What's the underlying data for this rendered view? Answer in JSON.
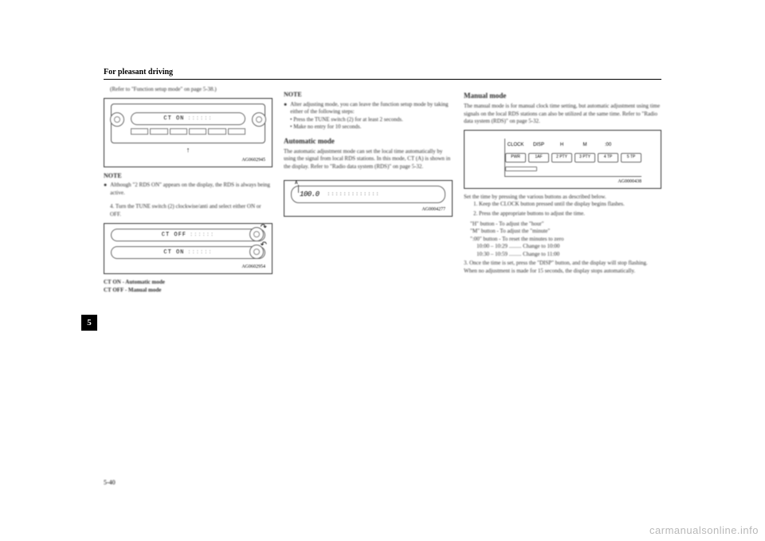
{
  "header": {
    "section_title": "For pleasant driving"
  },
  "tab": {
    "number": "5"
  },
  "footer": {
    "page_num": "5-40",
    "watermark": "carmanualsonline.info"
  },
  "col1": {
    "refer_text": "(Refer to \"Function setup mode\" on page 5-38.)",
    "fig1": {
      "lcd": "CT ON",
      "code": "AG0602945"
    },
    "note_label": "NOTE",
    "note_bullet": "Although \"2 RDS ON\" appears on the display, the RDS is always being active.",
    "step4": "4. Turn the TUNE switch (2) clockwise/anti and select either ON or OFF.",
    "fig2": {
      "lcd_off": "CT OFF",
      "lcd_on": "CT ON",
      "code": "AG0602954",
      "caption_on": "CT ON - Automatic mode",
      "caption_off": "CT OFF - Manual mode"
    }
  },
  "col2": {
    "note_label": "NOTE",
    "note_bullet": "Alter adjusting mode, you can leave the function setup mode by taking either of the following steps:",
    "note_sub1": "• Press the TUNE switch (2) for at least 2 seconds.",
    "note_sub2": "• Make no entry for 10 seconds.",
    "heading_auto": "Automatic mode",
    "auto_text": "The automatic adjustment mode can set the local time automatically by using the signal from local RDS stations. In this mode, CT (A) is shown in the display. Refer to \"Radio data system (RDS)\" on page 5-32.",
    "fig3": {
      "a_label": "A",
      "freq": "100.0",
      "code": "AG0004277"
    }
  },
  "col3": {
    "heading_manual": "Manual mode",
    "manual_text": "The manual mode is for manual clock time setting, but automatic adjustment using time signals on the local RDS stations can also be utilized at the same time. Refer to \"Radio data system (RDS)\" on page 5-32.",
    "fig4": {
      "labels": {
        "clock": "CLOCK",
        "disp": "DISP",
        "h": "H",
        "m": "M",
        "zero": ":00"
      },
      "btns": {
        "b1": "PWR",
        "b2": "1AF",
        "b3": "2 PTY",
        "b4": "3 PTY",
        "b5": "4 TP",
        "b6": "5 TP"
      },
      "code": "AG0000438"
    },
    "intro": "Set the time by pressing the various buttons as described below.",
    "step1": "1. Keep the CLOCK button pressed until the display begins flashes.",
    "step2": "2. Press the appropriate buttons to adjust the time.",
    "btn_h": "\"H\" button - To adjust the \"hour\"",
    "btn_m": "\"M\" button - To adjust the \"minute\"",
    "btn_00": "\":00\" button - To reset the minutes to zero",
    "range1": "10:00 – 10:29 ......... Change to 10:00",
    "range2": "10:30 – 10:59 ......... Change to 11:00",
    "step3": "3. Once the time is set, press the \"DISP\" button, and the display will stop flashing. When no adjustment is made for 15 seconds, the display stops automatically."
  }
}
